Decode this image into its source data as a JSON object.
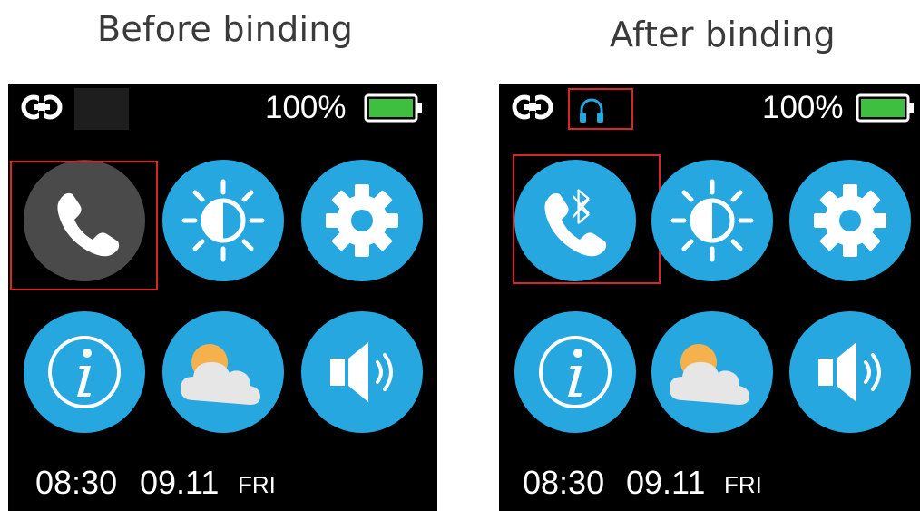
{
  "panels": {
    "before": {
      "title": "Before binding",
      "battery": "100%",
      "time": "08:30",
      "date": "09.11",
      "day": "FRI"
    },
    "after": {
      "title": "After binding",
      "battery": "100%",
      "time": "08:30",
      "date": "09.11",
      "day": "FRI"
    }
  },
  "apps": [
    "phone-icon",
    "brightness-icon",
    "settings-gear-icon",
    "info-icon",
    "weather-icon",
    "volume-icon"
  ],
  "colors": {
    "app_blue": "#27a7df",
    "app_disabled_grey": "#4a4a4a",
    "battery_green": "#3fbf3f",
    "highlight_red": "#d6262b",
    "headset_blue": "#27a7df"
  }
}
